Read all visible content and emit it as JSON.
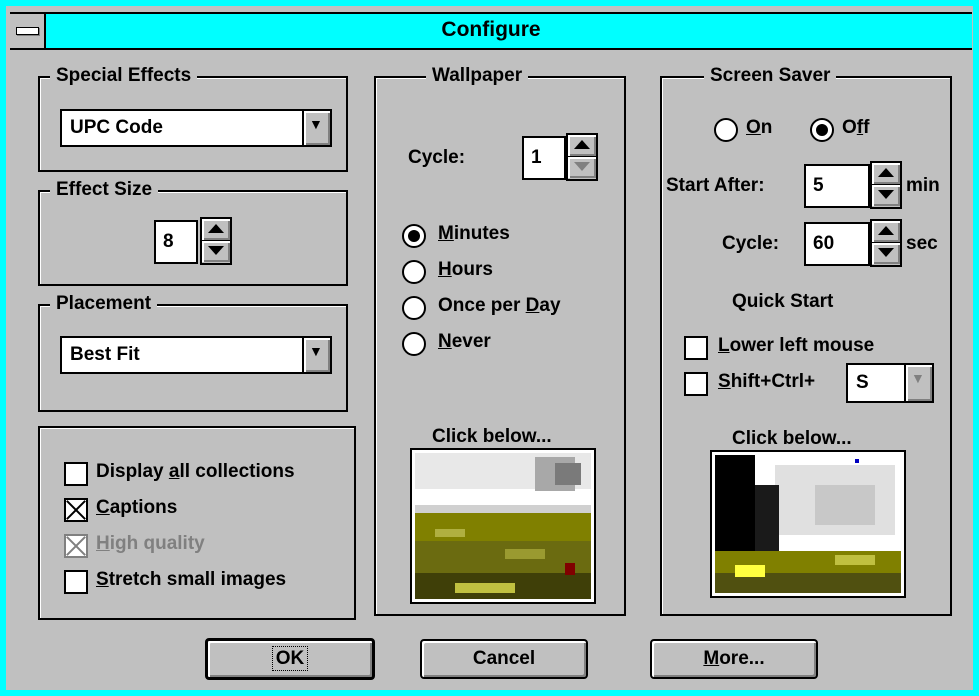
{
  "window": {
    "title": "Configure"
  },
  "special_effects": {
    "legend": "Special Effects",
    "selected": "UPC Code"
  },
  "effect_size": {
    "legend": "Effect Size",
    "value": "8"
  },
  "placement": {
    "legend": "Placement",
    "selected": "Best Fit"
  },
  "options": {
    "display_all": {
      "pre": "Display ",
      "u": "a",
      "post": "ll collections",
      "checked": false
    },
    "captions": {
      "pre": "",
      "u": "C",
      "post": "aptions",
      "checked": true
    },
    "high_quality": {
      "pre": "",
      "u": "H",
      "post": "igh quality",
      "checked": true,
      "disabled": true
    },
    "stretch": {
      "pre": "",
      "u": "S",
      "post": "tretch small images",
      "checked": false
    }
  },
  "wallpaper": {
    "legend": "Wallpaper",
    "cycle_label": "Cycle:",
    "cycle_value": "1",
    "minutes": {
      "u": "M",
      "post": "inutes",
      "selected": true
    },
    "hours": {
      "u": "H",
      "post": "ours",
      "selected": false
    },
    "once_per_day": {
      "pre": "Once per ",
      "u": "D",
      "post": "ay",
      "selected": false
    },
    "never": {
      "u": "N",
      "post": "ever",
      "selected": false
    },
    "click_below": "Click below..."
  },
  "screen_saver": {
    "legend": "Screen Saver",
    "on": {
      "u": "O",
      "post": "n",
      "selected": false
    },
    "off": {
      "pre": "O",
      "u": "f",
      "post": "f",
      "selected": true
    },
    "start_after_label": "Start After:",
    "start_after_value": "5",
    "start_after_unit": "min",
    "cycle_label": "Cycle:",
    "cycle_value": "60",
    "cycle_unit": "sec",
    "quick_start_label": "Quick Start",
    "lower_left": {
      "u": "L",
      "post": "ower left mouse",
      "checked": false
    },
    "shift_ctrl": {
      "u": "S",
      "post": "hift+Ctrl+",
      "checked": false
    },
    "hotkey_value": "S",
    "click_below": "Click below..."
  },
  "buttons": {
    "ok": "OK",
    "cancel": "Cancel",
    "more": {
      "u": "M",
      "post": "ore..."
    }
  },
  "colors": {
    "titlebar": "#00ffff",
    "face": "#c0c0c0"
  }
}
